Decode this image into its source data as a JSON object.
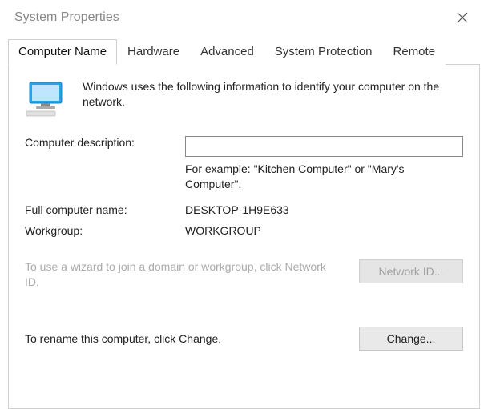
{
  "window": {
    "title": "System Properties"
  },
  "tabs": {
    "computerName": "Computer Name",
    "hardware": "Hardware",
    "advanced": "Advanced",
    "systemProtection": "System Protection",
    "remote": "Remote"
  },
  "content": {
    "intro": "Windows uses the following information to identify your computer on the network.",
    "descLabel": "Computer description:",
    "descValue": "",
    "descHint": "For example: \"Kitchen Computer\" or \"Mary's Computer\".",
    "fullNameLabel": "Full computer name:",
    "fullNameValue": "DESKTOP-1H9E633",
    "workgroupLabel": "Workgroup:",
    "workgroupValue": "WORKGROUP",
    "wizardText": "To use a wizard to join a domain or workgroup, click Network ID.",
    "networkIdBtn": "Network ID...",
    "renameText": "To rename this computer, click Change.",
    "changeBtn": "Change..."
  }
}
